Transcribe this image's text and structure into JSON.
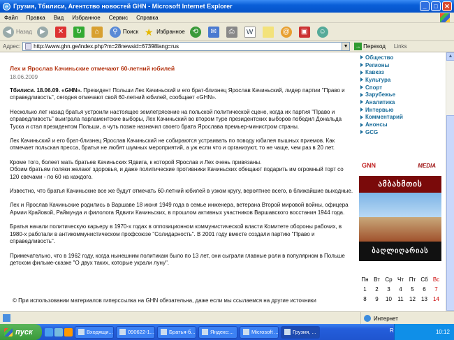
{
  "window": {
    "title": "Грузия, Тбилиси, Агентство новостей GHN - Microsoft Internet Explorer"
  },
  "menu": [
    "Файл",
    "Правка",
    "Вид",
    "Избранное",
    "Сервис",
    "Справка"
  ],
  "toolbar": {
    "back": "Назад",
    "search": "Поиск",
    "favorites": "Избранное"
  },
  "address": {
    "label": "Адрес:",
    "url": "http://www.ghn.ge/index.php?m=28newsid=67398lang=rus",
    "go": "Переход",
    "links": "Links"
  },
  "article": {
    "title": "Лех и Ярослав Качиньские отмечают 60-летний юбилей",
    "date": "18.06.2009",
    "lead_bold": "Тбилиси. 18.06.09. «GHN».",
    "lead": " Президент Польши Лех Качиньский и его брат-близнец Ярослав Качиньский, лидер партии \"Право и справедливость\", сегодня отмечают свой 60-летний юбилей, сообщает «GHN».",
    "p1": "Несколько лет назад братья устроили настоящее землетрясение на польской политической сцене, когда их партия \"Право и справедливость\" выиграла парламентские выборы, Лех Качиньский во втором туре президентских выборов победил Дональда Туска и стал президентом Польши, а чуть позже назначил своего брата Ярослава премьер-министром страны.",
    "p2": "Лех Качиньский и его брат-близнец Ярослав Качиньский не собираются устраивать по поводу юбилея пышных приемов. Как отмечает польская пресса, братья не любят шумных мероприятий, а уж если что и организуют, то не чаще, чем раз в 20 лет.",
    "p3a": "Кроме того, болеет мать братьев Качиньских Ядвига, к которой Ярослав и Лех очень привязаны.",
    "p3b": "Обоим братьям поляки желают здоровья, и даже политические противники Качиньских обещают подарить им огромный торт со 120 свечами - по 60 на каждого.",
    "p4": "Известно, что братья Качиньские все же будут отмечать 60-летний юбилей в узком кругу, вероятнее всего, в ближайшие выходные.",
    "p5": "Лех и Ярослав Качиньские родились в Варшаве 18 июня 1949 года в семье инженера, ветерана Второй мировой войны, офицера Армии Крайовой, Раймунда и филолога Ядвиги Качиньских, в прошлом активных участников Варшавского восстания 1944 года.",
    "p6": "Братья начали политическую карьеру в 1970-х годах в оппозиционном коммунистической власти Комитете обороны рабочих, в 1980-х работали в антикоммунистическом профсоюзе \"Солидарность\". В 2001 году вместе создали партию \"Право и справедливость\".",
    "p7": "Примечательно, что в 1962 году, когда нынешним политикам было по 13 лет, они сыграли главные роли в популярном в Польше детском фильме-сказке \"О двух таких, которые украли луну\".",
    "copyright": "© При использовании материалов гиперссылка на GHN обязательна, даже если мы ссылаемся на другие источники"
  },
  "sidebar": {
    "nav": [
      "Общество",
      "Регионы",
      "Кавказ",
      "Культура",
      "Спорт",
      "Зарубежье",
      "Аналитика",
      "Интервью",
      "Комментарий",
      "Анонсы",
      "GCG"
    ],
    "banner_gnn": "GNN",
    "banner_media": "MEDIA",
    "banner_geo1": "ამბახმთის",
    "banner_geo2": "ბაღლიღარიას"
  },
  "calendar": {
    "days": [
      "Пн",
      "Вт",
      "Ср",
      "Чт",
      "Пт",
      "Сб",
      "Вс"
    ],
    "week1": [
      "1",
      "2",
      "3",
      "4",
      "5",
      "6",
      "7"
    ],
    "week2": [
      "8",
      "9",
      "10",
      "11",
      "12",
      "13",
      "14"
    ]
  },
  "status": {
    "zone": "Интернет"
  },
  "taskbar": {
    "start": "пуск",
    "tasks": [
      "Входящи...",
      "090622-1...",
      "Братья-б...",
      "Яндекс:...",
      "Microsoft ...",
      "Грузия, ..."
    ],
    "lang": "RU",
    "clock": "10:12"
  },
  "colors": {
    "accent": "#b33310",
    "nav": "#1a6d9a",
    "titlebar": "#0a5fd8"
  }
}
